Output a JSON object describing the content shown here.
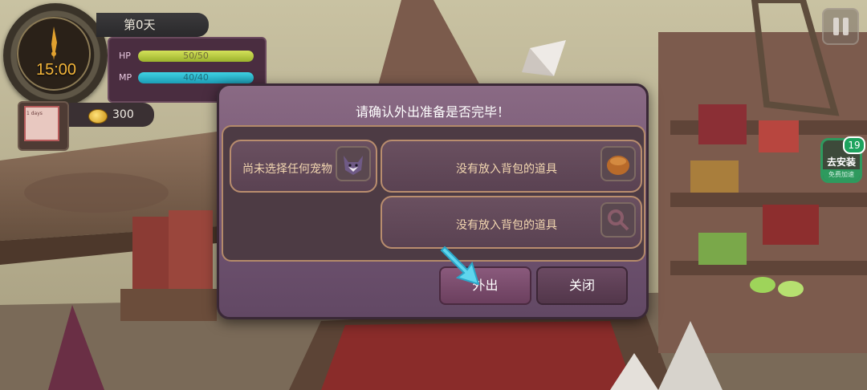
{
  "hud": {
    "clock_time": "15:00",
    "day": "第0天",
    "hp_label": "HP",
    "hp_value": "50/50",
    "hp_fraction": 1.0,
    "mp_label": "MP",
    "mp_value": "40/40",
    "mp_fraction": 1.0,
    "gold": "300",
    "book_text": "1 days"
  },
  "install": {
    "label": "去安装",
    "sub": "免费加速",
    "badge": "19"
  },
  "dialog": {
    "title": "请确认外出准备是否完毕！",
    "pet_slot": "尚未选择任何宠物",
    "item_slot_1": "没有放入背包的道具",
    "item_slot_2": "没有放入背包的道具",
    "go_button": "外出",
    "close_button": "关闭"
  },
  "colors": {
    "dialog_bg": "#6f5370",
    "slot_text": "#f2d6b0",
    "hp_bar": "#c5d84a",
    "mp_bar": "#2fb8cf",
    "clock_text": "#f3b53a"
  }
}
